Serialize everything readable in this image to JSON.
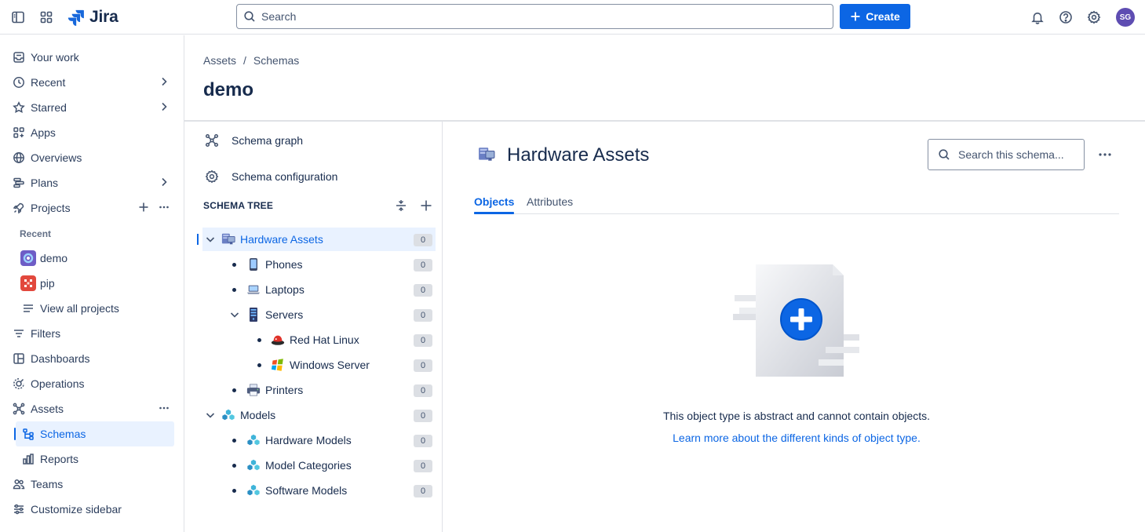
{
  "app": {
    "name": "Jira"
  },
  "search": {
    "placeholder": "Search"
  },
  "header": {
    "create_label": "Create",
    "avatar_initials": "SG"
  },
  "sidebar": {
    "items": [
      {
        "label": "Your work"
      },
      {
        "label": "Recent"
      },
      {
        "label": "Starred"
      },
      {
        "label": "Apps"
      },
      {
        "label": "Overviews"
      },
      {
        "label": "Plans"
      },
      {
        "label": "Projects"
      },
      {
        "label": "Recent"
      },
      {
        "label": "demo"
      },
      {
        "label": "pip"
      },
      {
        "label": "View all projects"
      },
      {
        "label": "Filters"
      },
      {
        "label": "Dashboards"
      },
      {
        "label": "Operations"
      },
      {
        "label": "Assets"
      },
      {
        "label": "Schemas"
      },
      {
        "label": "Reports"
      },
      {
        "label": "Teams"
      },
      {
        "label": "Customize sidebar"
      }
    ]
  },
  "breadcrumb": {
    "root": "Assets",
    "separator": "/",
    "current": "Schemas"
  },
  "page": {
    "title": "demo"
  },
  "schema_panel": {
    "graph_label": "Schema graph",
    "config_label": "Schema configuration",
    "tree_heading": "SCHEMA TREE",
    "nodes": [
      {
        "label": "Hardware Assets",
        "count": "0"
      },
      {
        "label": "Phones",
        "count": "0"
      },
      {
        "label": "Laptops",
        "count": "0"
      },
      {
        "label": "Servers",
        "count": "0"
      },
      {
        "label": "Red Hat Linux",
        "count": "0"
      },
      {
        "label": "Windows Server",
        "count": "0"
      },
      {
        "label": "Printers",
        "count": "0"
      },
      {
        "label": "Models",
        "count": "0"
      },
      {
        "label": "Hardware Models",
        "count": "0"
      },
      {
        "label": "Model Categories",
        "count": "0"
      },
      {
        "label": "Software Models",
        "count": "0"
      }
    ]
  },
  "detail": {
    "title": "Hardware Assets",
    "search_placeholder": "Search this schema...",
    "tabs": [
      {
        "label": "Objects"
      },
      {
        "label": "Attributes"
      }
    ],
    "empty_message": "This object type is abstract and cannot contain objects.",
    "learn_more": "Learn more about the different kinds of object type."
  },
  "colors": {
    "accent": "#0c66e4",
    "selected_bg": "#e9f2ff",
    "text": "#172b4d",
    "border": "#dfe1e6"
  }
}
